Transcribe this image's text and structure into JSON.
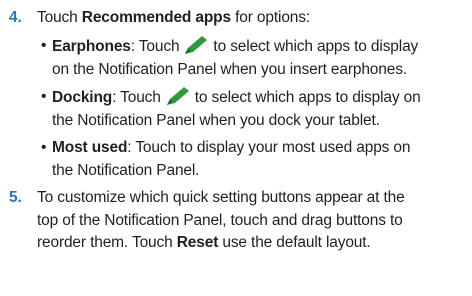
{
  "steps": [
    {
      "number": "4.",
      "intro_prefix": "Touch ",
      "intro_bold": "Recommended apps",
      "intro_suffix": " for options:",
      "bullets": [
        {
          "bullet": "•",
          "term": "Earphones",
          "colon": ": Touch",
          "icon": "pencil-icon",
          "line1_rest": "to select which apps to display",
          "line2": "on the Notification Panel when you insert earphones."
        },
        {
          "bullet": "•",
          "term": "Docking",
          "colon": ": Touch",
          "icon": "pencil-icon",
          "line1_rest": "to select which apps to display on",
          "line2": "the Notification Panel when you dock your tablet."
        },
        {
          "bullet": "•",
          "term": "Most used",
          "line1_rest": ": Touch to display your most used apps on",
          "line2": "the Notification Panel."
        }
      ]
    },
    {
      "number": "5.",
      "line1": "To customize which quick setting buttons appear at the",
      "line2": "top of the Notification Panel, touch and drag buttons to",
      "line3_prefix": "reorder them. Touch ",
      "line3_bold": "Reset",
      "line3_suffix": " use the default layout."
    }
  ],
  "colors": {
    "step_number": "#2a77b8",
    "text": "#231f20",
    "pencil_icon": "#2e9a3e"
  }
}
